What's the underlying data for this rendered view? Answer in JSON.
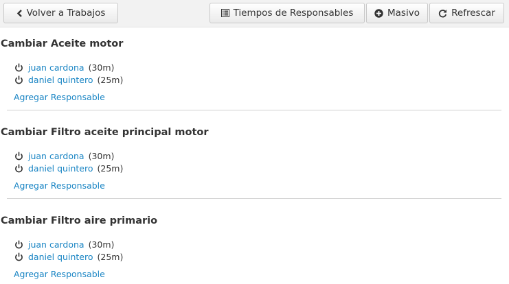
{
  "toolbar": {
    "back_label": "Volver a Trabajos",
    "times_label": "Tiempos de Responsables",
    "massive_label": "Masivo",
    "refresh_label": "Refrescar"
  },
  "tasks": [
    {
      "title": "Cambiar Aceite motor",
      "responsables": [
        {
          "name": "juan cardona",
          "duration": "(30m)"
        },
        {
          "name": "daniel quintero",
          "duration": "(25m)"
        }
      ],
      "add_label": "Agregar Responsable"
    },
    {
      "title": "Cambiar Filtro aceite principal motor",
      "responsables": [
        {
          "name": "juan cardona",
          "duration": "(30m)"
        },
        {
          "name": "daniel quintero",
          "duration": "(25m)"
        }
      ],
      "add_label": "Agregar Responsable"
    },
    {
      "title": "Cambiar Filtro aire primario",
      "responsables": [
        {
          "name": "juan cardona",
          "duration": "(30m)"
        },
        {
          "name": "daniel quintero",
          "duration": "(25m)"
        }
      ],
      "add_label": "Agregar Responsable"
    }
  ],
  "colors": {
    "link": "#1a85c4",
    "toolbar_bg": "#f2f2f2",
    "text": "#333333"
  },
  "icons": {
    "back": "chevron-left-icon",
    "times": "list-icon",
    "massive": "plus-circle-icon",
    "refresh": "refresh-icon",
    "responsable": "power-icon"
  }
}
